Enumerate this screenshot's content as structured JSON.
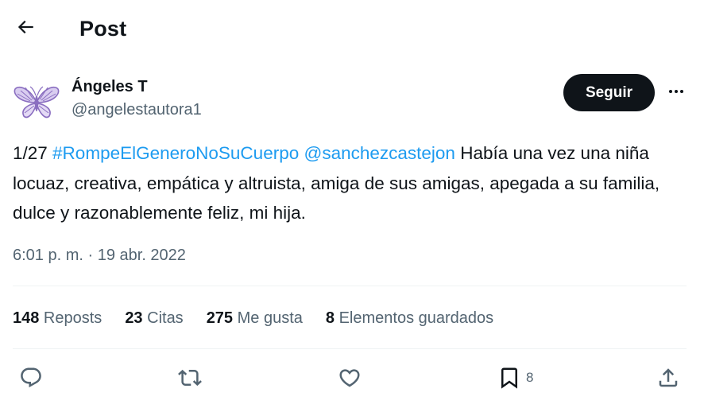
{
  "header": {
    "title": "Post",
    "back_icon": "arrow-left-icon"
  },
  "author": {
    "name": "Ángeles T",
    "handle": "@angelestautora1",
    "avatar_icon": "butterfly-icon",
    "avatar_color": "#8a6ec0"
  },
  "follow_button": {
    "label": "Seguir"
  },
  "more_icon": "more-horizontal-icon",
  "tweet": {
    "prefix": "1/27 ",
    "hashtag": "#RompeElGeneroNoSuCuerpo",
    "space": " ",
    "mention": "@sanchezcastejon",
    "body": " Había una vez una niña locuaz, creativa, empática y altruista, amiga de sus amigas, apegada a su familia, dulce y razonablemente feliz, mi hija."
  },
  "timestamp": "6:01 p. m. · 19 abr. 2022",
  "stats": {
    "reposts": {
      "count": "148",
      "label": " Reposts"
    },
    "quotes": {
      "count": "23",
      "label": " Citas"
    },
    "likes": {
      "count": "275",
      "label": " Me gusta"
    },
    "bookmarks": {
      "count": "8",
      "label": " Elementos guardados"
    }
  },
  "actions": {
    "reply_icon": "reply-icon",
    "repost_icon": "repost-icon",
    "like_icon": "heart-icon",
    "bookmark_icon": "bookmark-icon",
    "bookmark_count": "8",
    "share_icon": "share-icon"
  },
  "colors": {
    "link": "#1d9bf0",
    "text": "#0f1419",
    "secondary": "#536471",
    "button_bg": "#0f1419",
    "divider": "#eff3f4"
  }
}
